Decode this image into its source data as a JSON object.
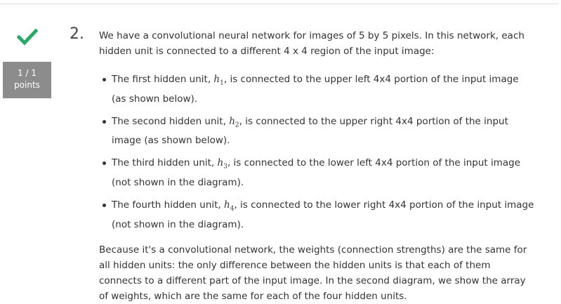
{
  "colors": {
    "check": "#2ea86a",
    "points_bg": "#8c8c8c"
  },
  "icons": {
    "status": "check-icon"
  },
  "score": {
    "value": "1 / 1",
    "label": "points"
  },
  "question": {
    "number": "2.",
    "intro": "We have a convolutional neural network for images of 5 by 5 pixels. In this network, each hidden unit is connected to a different 4 x 4 region of the input image:",
    "bullets": [
      {
        "pre": "The first hidden unit, ",
        "var": "h",
        "sub": "1",
        "post": ", is connected to the upper left 4x4 portion of the input image (as shown below)."
      },
      {
        "pre": "The second hidden unit, ",
        "var": "h",
        "sub": "2",
        "post": ", is connected to the upper right 4x4 portion of the input image (as shown below)."
      },
      {
        "pre": "The third hidden unit, ",
        "var": "h",
        "sub": "3",
        "post": ", is connected to the lower left 4x4 portion of the input image (not shown in the diagram)."
      },
      {
        "pre": "The fourth hidden unit, ",
        "var": "h",
        "sub": "4",
        "post": ", is connected to the lower right 4x4 portion of the input image (not shown in the diagram)."
      }
    ],
    "para2": "Because it's a convolutional network, the weights (connection strengths) are the same for all hidden units: the only difference between the hidden units is that each of them connects to a different part of the input image. In the second diagram, we show the array of weights, which are the same for each of the four hidden units."
  }
}
